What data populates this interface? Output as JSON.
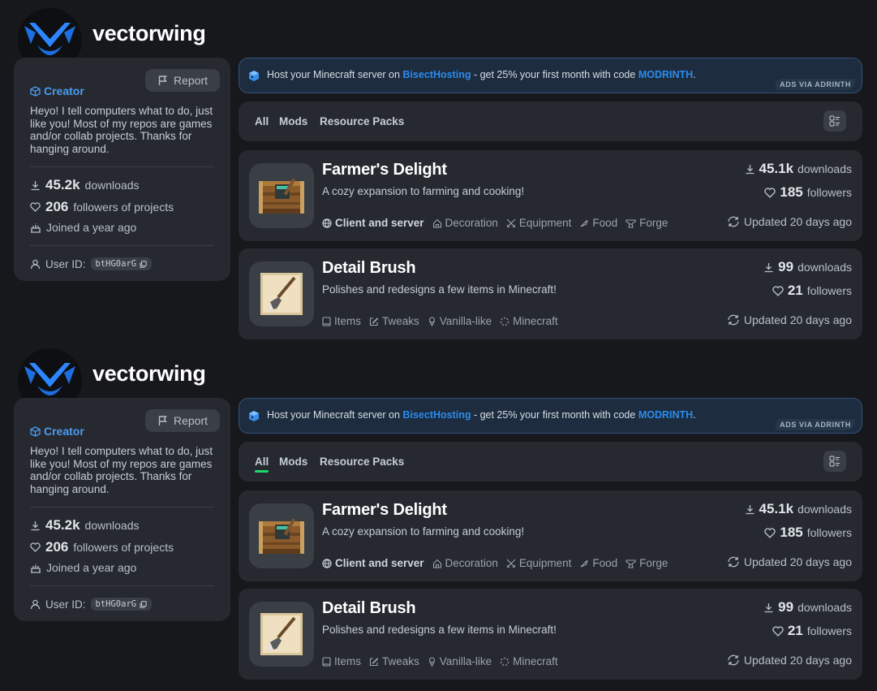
{
  "sections": [
    {
      "profile": {
        "username": "vectorwing",
        "report_label": "Report",
        "creator_label": "Creator",
        "bio": "Heyo! I tell computers what to do, just like you! Most of my repos are games and/or collab projects. Thanks for hanging around.",
        "downloads_value": "45.2k",
        "downloads_label": "downloads",
        "followers_value": "206",
        "followers_label": "followers of projects",
        "joined": "Joined a year ago",
        "user_id_label": "User ID:",
        "user_id": "btHG0arG"
      },
      "ad": {
        "prefix": "Host your Minecraft server on ",
        "host": "BisectHosting",
        "middle": " - get 25% your first month with code ",
        "code": "MODRINTH",
        "suffix": ".",
        "tag": "ADS VIA ADRINTH"
      },
      "filters": {
        "all": "All",
        "mods": "Mods",
        "resource_packs": "Resource Packs",
        "active_underline": false
      },
      "projects": [
        {
          "title": "Farmer's Delight",
          "description": "A cozy expansion to farming and cooking!",
          "downloads_value": "45.1k",
          "downloads_label": "downloads",
          "followers_value": "185",
          "followers_label": "followers",
          "updated": "Updated 20 days ago",
          "tags": [
            "Client and server",
            "Decoration",
            "Equipment",
            "Food",
            "Forge"
          ]
        },
        {
          "title": "Detail Brush",
          "description": "Polishes and redesigns a few items in Minecraft!",
          "downloads_value": "99",
          "downloads_label": "downloads",
          "followers_value": "21",
          "followers_label": "followers",
          "updated": "Updated 20 days ago",
          "tags": [
            "Items",
            "Tweaks",
            "Vanilla-like",
            "Minecraft"
          ]
        }
      ]
    },
    {
      "profile": {
        "username": "vectorwing",
        "report_label": "Report",
        "creator_label": "Creator",
        "bio": "Heyo! I tell computers what to do, just like you! Most of my repos are games and/or collab projects. Thanks for hanging around.",
        "downloads_value": "45.2k",
        "downloads_label": "downloads",
        "followers_value": "206",
        "followers_label": "followers of projects",
        "joined": "Joined a year ago",
        "user_id_label": "User ID:",
        "user_id": "btHG0arG"
      },
      "ad": {
        "prefix": "Host your Minecraft server on ",
        "host": "BisectHosting",
        "middle": " - get 25% your first month with code ",
        "code": "MODRINTH",
        "suffix": ".",
        "tag": "ADS VIA ADRINTH"
      },
      "filters": {
        "all": "All",
        "mods": "Mods",
        "resource_packs": "Resource Packs",
        "active_underline": true
      },
      "projects": [
        {
          "title": "Farmer's Delight",
          "description": "A cozy expansion to farming and cooking!",
          "downloads_value": "45.1k",
          "downloads_label": "downloads",
          "followers_value": "185",
          "followers_label": "followers",
          "updated": "Updated 20 days ago",
          "tags": [
            "Client and server",
            "Decoration",
            "Equipment",
            "Food",
            "Forge"
          ]
        },
        {
          "title": "Detail Brush",
          "description": "Polishes and redesigns a few items in Minecraft!",
          "downloads_value": "99",
          "downloads_label": "downloads",
          "followers_value": "21",
          "followers_label": "followers",
          "updated": "Updated 20 days ago",
          "tags": [
            "Items",
            "Tweaks",
            "Vanilla-like",
            "Minecraft"
          ]
        }
      ]
    }
  ],
  "colors": {
    "accent_blue": "#4b9cf0",
    "ad_link": "#2a8cf0",
    "active_tab": "#1bd96a",
    "background": "#16181c",
    "card": "#26292f"
  }
}
